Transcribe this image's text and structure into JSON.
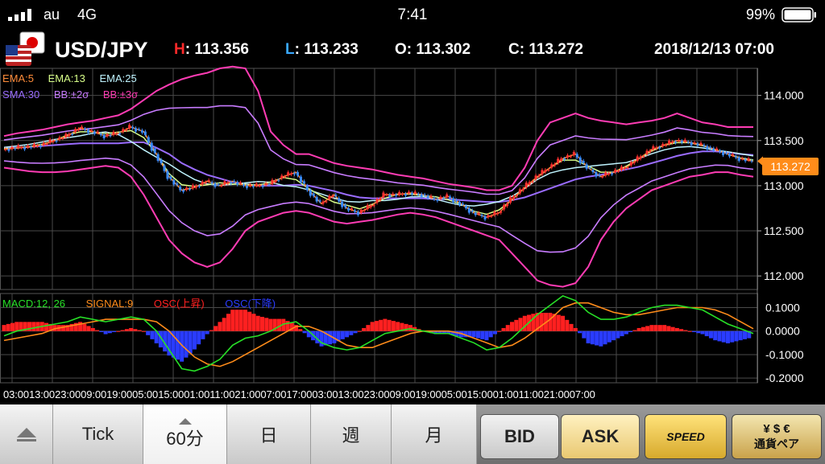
{
  "status_bar": {
    "carrier": "au",
    "network": "4G",
    "time": "7:41",
    "battery": "99%"
  },
  "header": {
    "pair": "USD/JPY",
    "high_label": "H",
    "high": "113.356",
    "low_label": "L",
    "low": "113.233",
    "open_label": "O",
    "open": "113.302",
    "close_label": "C",
    "close": "113.272",
    "datetime": "2018/12/13 07:00"
  },
  "price_legend": [
    {
      "text": "EMA:5",
      "color": "#ff8c3a"
    },
    {
      "text": "EMA:13",
      "color": "#d8ff8a"
    },
    {
      "text": "EMA:25",
      "color": "#bff4ff"
    },
    {
      "text": "SMA:30",
      "color": "#9a6cff"
    },
    {
      "text": "BB:±2σ",
      "color": "#c87cff"
    },
    {
      "text": "BB:±3σ",
      "color": "#ff3cb4"
    }
  ],
  "macd_legend": [
    {
      "text": "MACD:12, 26",
      "color": "#27e027"
    },
    {
      "text": "SIGNAL:9",
      "color": "#ff8c1a"
    },
    {
      "text": "OSC(上昇)",
      "color": "#ff2020"
    },
    {
      "text": "OSC(下降)",
      "color": "#2a3cff"
    }
  ],
  "price_axis": {
    "ticks": [
      "114.000",
      "113.500",
      "113.000",
      "112.500",
      "112.000"
    ],
    "current": "113.272"
  },
  "macd_axis": {
    "ticks": [
      "0.1000",
      "0.0000",
      "-0.1000",
      "-0.2000"
    ]
  },
  "time_axis": "03:0013:0023:0009:0019:0005:0015:0001:0011:0021:0007:0017:0003:0013:0023:0009:0019:0005:0015:0001:0011:0021:0007:00",
  "tabs": [
    "Tick",
    "60分",
    "日",
    "週",
    "月"
  ],
  "buttons": {
    "bid": "BID",
    "ask": "ASK",
    "speed": "SPEED",
    "currency_pair": "通貨ペア"
  },
  "colors": {
    "ema5": "#ff8c3a",
    "ema13": "#d8ff8a",
    "ema25": "#bff4ff",
    "sma30": "#9a6cff",
    "bb2": "#c87cff",
    "bb3": "#ff3cb4",
    "macd": "#27e027",
    "signal": "#ff8c1a",
    "osc_up": "#ff2020",
    "osc_down": "#2a3cff",
    "price_tag": "#ff8c1a"
  },
  "chart_data": [
    {
      "type": "line",
      "x": [
        0,
        4,
        8,
        12,
        16,
        20,
        24,
        28,
        32,
        36,
        40,
        44,
        48,
        52,
        56,
        60,
        64,
        68,
        72,
        76,
        80,
        84,
        88,
        92,
        96,
        100,
        104,
        108,
        112,
        116,
        120,
        124,
        128,
        132,
        136,
        140,
        144,
        148,
        152,
        156,
        160,
        164,
        168,
        172,
        176,
        180,
        184,
        188,
        192,
        196,
        200,
        204,
        208,
        212,
        216,
        220,
        224,
        228,
        232,
        236
      ],
      "series": [
        {
          "name": "EMA:5",
          "values": [
            113.4,
            113.42,
            113.43,
            113.45,
            113.5,
            113.55,
            113.64,
            113.6,
            113.55,
            113.58,
            113.65,
            113.6,
            113.35,
            113.1,
            112.95,
            112.98,
            113.05,
            113.0,
            113.05,
            113.0,
            113.0,
            113.02,
            113.1,
            113.15,
            112.95,
            112.8,
            112.9,
            112.75,
            112.7,
            112.78,
            112.9,
            112.9,
            112.92,
            112.9,
            112.85,
            112.88,
            112.8,
            112.7,
            112.65,
            112.7,
            112.85,
            112.98,
            113.1,
            113.2,
            113.3,
            113.35,
            113.2,
            113.1,
            113.15,
            113.2,
            113.3,
            113.4,
            113.45,
            113.5,
            113.48,
            113.45,
            113.4,
            113.35,
            113.3,
            113.27
          ]
        },
        {
          "name": "SMA:30",
          "values": [
            113.42,
            113.42,
            113.43,
            113.44,
            113.45,
            113.46,
            113.47,
            113.47,
            113.47,
            113.47,
            113.48,
            113.48,
            113.42,
            113.35,
            113.25,
            113.18,
            113.12,
            113.08,
            113.04,
            113.02,
            113.0,
            113.0,
            113.0,
            113.01,
            113.0,
            112.97,
            112.94,
            112.9,
            112.87,
            112.86,
            112.86,
            112.86,
            112.86,
            112.86,
            112.85,
            112.85,
            112.84,
            112.83,
            112.82,
            112.82,
            112.84,
            112.87,
            112.92,
            112.97,
            113.02,
            113.07,
            113.1,
            113.12,
            113.15,
            113.18,
            113.21,
            113.25,
            113.29,
            113.33,
            113.36,
            113.38,
            113.38,
            113.37,
            113.35,
            113.34
          ]
        },
        {
          "name": "BB:+3σ",
          "values": [
            113.55,
            113.58,
            113.6,
            113.62,
            113.65,
            113.68,
            113.7,
            113.72,
            113.75,
            113.78,
            113.85,
            113.95,
            114.05,
            114.12,
            114.18,
            114.22,
            114.25,
            114.3,
            114.32,
            114.3,
            114.05,
            113.6,
            113.45,
            113.35,
            113.35,
            113.3,
            113.25,
            113.22,
            113.2,
            113.18,
            113.15,
            113.12,
            113.1,
            113.08,
            113.05,
            113.02,
            113.0,
            112.98,
            112.95,
            112.95,
            113.0,
            113.2,
            113.5,
            113.7,
            113.75,
            113.8,
            113.75,
            113.72,
            113.7,
            113.68,
            113.7,
            113.72,
            113.75,
            113.8,
            113.75,
            113.7,
            113.68,
            113.65,
            113.65,
            113.65
          ]
        },
        {
          "name": "BB:-3σ",
          "values": [
            113.2,
            113.18,
            113.16,
            113.15,
            113.15,
            113.16,
            113.18,
            113.2,
            113.22,
            113.2,
            113.1,
            112.9,
            112.65,
            112.4,
            112.25,
            112.15,
            112.1,
            112.15,
            112.3,
            112.5,
            112.6,
            112.65,
            112.7,
            112.72,
            112.7,
            112.65,
            112.6,
            112.58,
            112.6,
            112.62,
            112.65,
            112.68,
            112.7,
            112.68,
            112.65,
            112.6,
            112.55,
            112.5,
            112.45,
            112.4,
            112.25,
            112.1,
            111.95,
            111.9,
            111.88,
            111.92,
            112.1,
            112.4,
            112.6,
            112.75,
            112.85,
            112.95,
            113.0,
            113.05,
            113.1,
            113.12,
            113.15,
            113.15,
            113.12,
            113.1
          ]
        }
      ],
      "ylim": [
        111.85,
        114.3
      ]
    },
    {
      "type": "bar",
      "x": [
        0,
        4,
        8,
        12,
        16,
        20,
        24,
        28,
        32,
        36,
        40,
        44,
        48,
        52,
        56,
        60,
        64,
        68,
        72,
        76,
        80,
        84,
        88,
        92,
        96,
        100,
        104,
        108,
        112,
        116,
        120,
        124,
        128,
        132,
        136,
        140,
        144,
        148,
        152,
        156,
        160,
        164,
        168,
        172,
        176,
        180,
        184,
        188,
        192,
        196,
        200,
        204,
        208,
        212,
        216,
        220,
        224,
        228,
        232,
        236
      ],
      "series": [
        {
          "name": "MACD:12, 26",
          "values": [
            -0.02,
            0.0,
            0.01,
            0.02,
            0.03,
            0.04,
            0.06,
            0.05,
            0.04,
            0.05,
            0.06,
            0.05,
            0.0,
            -0.08,
            -0.16,
            -0.17,
            -0.15,
            -0.12,
            -0.06,
            -0.03,
            -0.02,
            0.0,
            0.03,
            0.04,
            0.0,
            -0.05,
            -0.07,
            -0.08,
            -0.07,
            -0.04,
            -0.01,
            0.0,
            0.01,
            0.0,
            -0.01,
            -0.01,
            -0.03,
            -0.05,
            -0.08,
            -0.07,
            -0.03,
            0.02,
            0.07,
            0.11,
            0.15,
            0.13,
            0.08,
            0.05,
            0.05,
            0.06,
            0.08,
            0.1,
            0.11,
            0.11,
            0.1,
            0.09,
            0.06,
            0.03,
            0.01,
            -0.01
          ]
        },
        {
          "name": "SIGNAL:9",
          "values": [
            -0.04,
            -0.03,
            -0.02,
            -0.01,
            0.01,
            0.02,
            0.03,
            0.04,
            0.05,
            0.05,
            0.05,
            0.05,
            0.04,
            0.0,
            -0.06,
            -0.11,
            -0.14,
            -0.15,
            -0.13,
            -0.1,
            -0.07,
            -0.04,
            -0.01,
            0.02,
            0.02,
            0.0,
            -0.03,
            -0.06,
            -0.07,
            -0.07,
            -0.05,
            -0.03,
            -0.01,
            0.0,
            0.0,
            0.0,
            -0.01,
            -0.03,
            -0.05,
            -0.07,
            -0.06,
            -0.03,
            0.01,
            0.05,
            0.1,
            0.12,
            0.12,
            0.1,
            0.08,
            0.07,
            0.07,
            0.08,
            0.09,
            0.1,
            0.1,
            0.1,
            0.09,
            0.07,
            0.04,
            0.01
          ]
        }
      ],
      "ylim": [
        -0.22,
        0.16
      ]
    }
  ]
}
